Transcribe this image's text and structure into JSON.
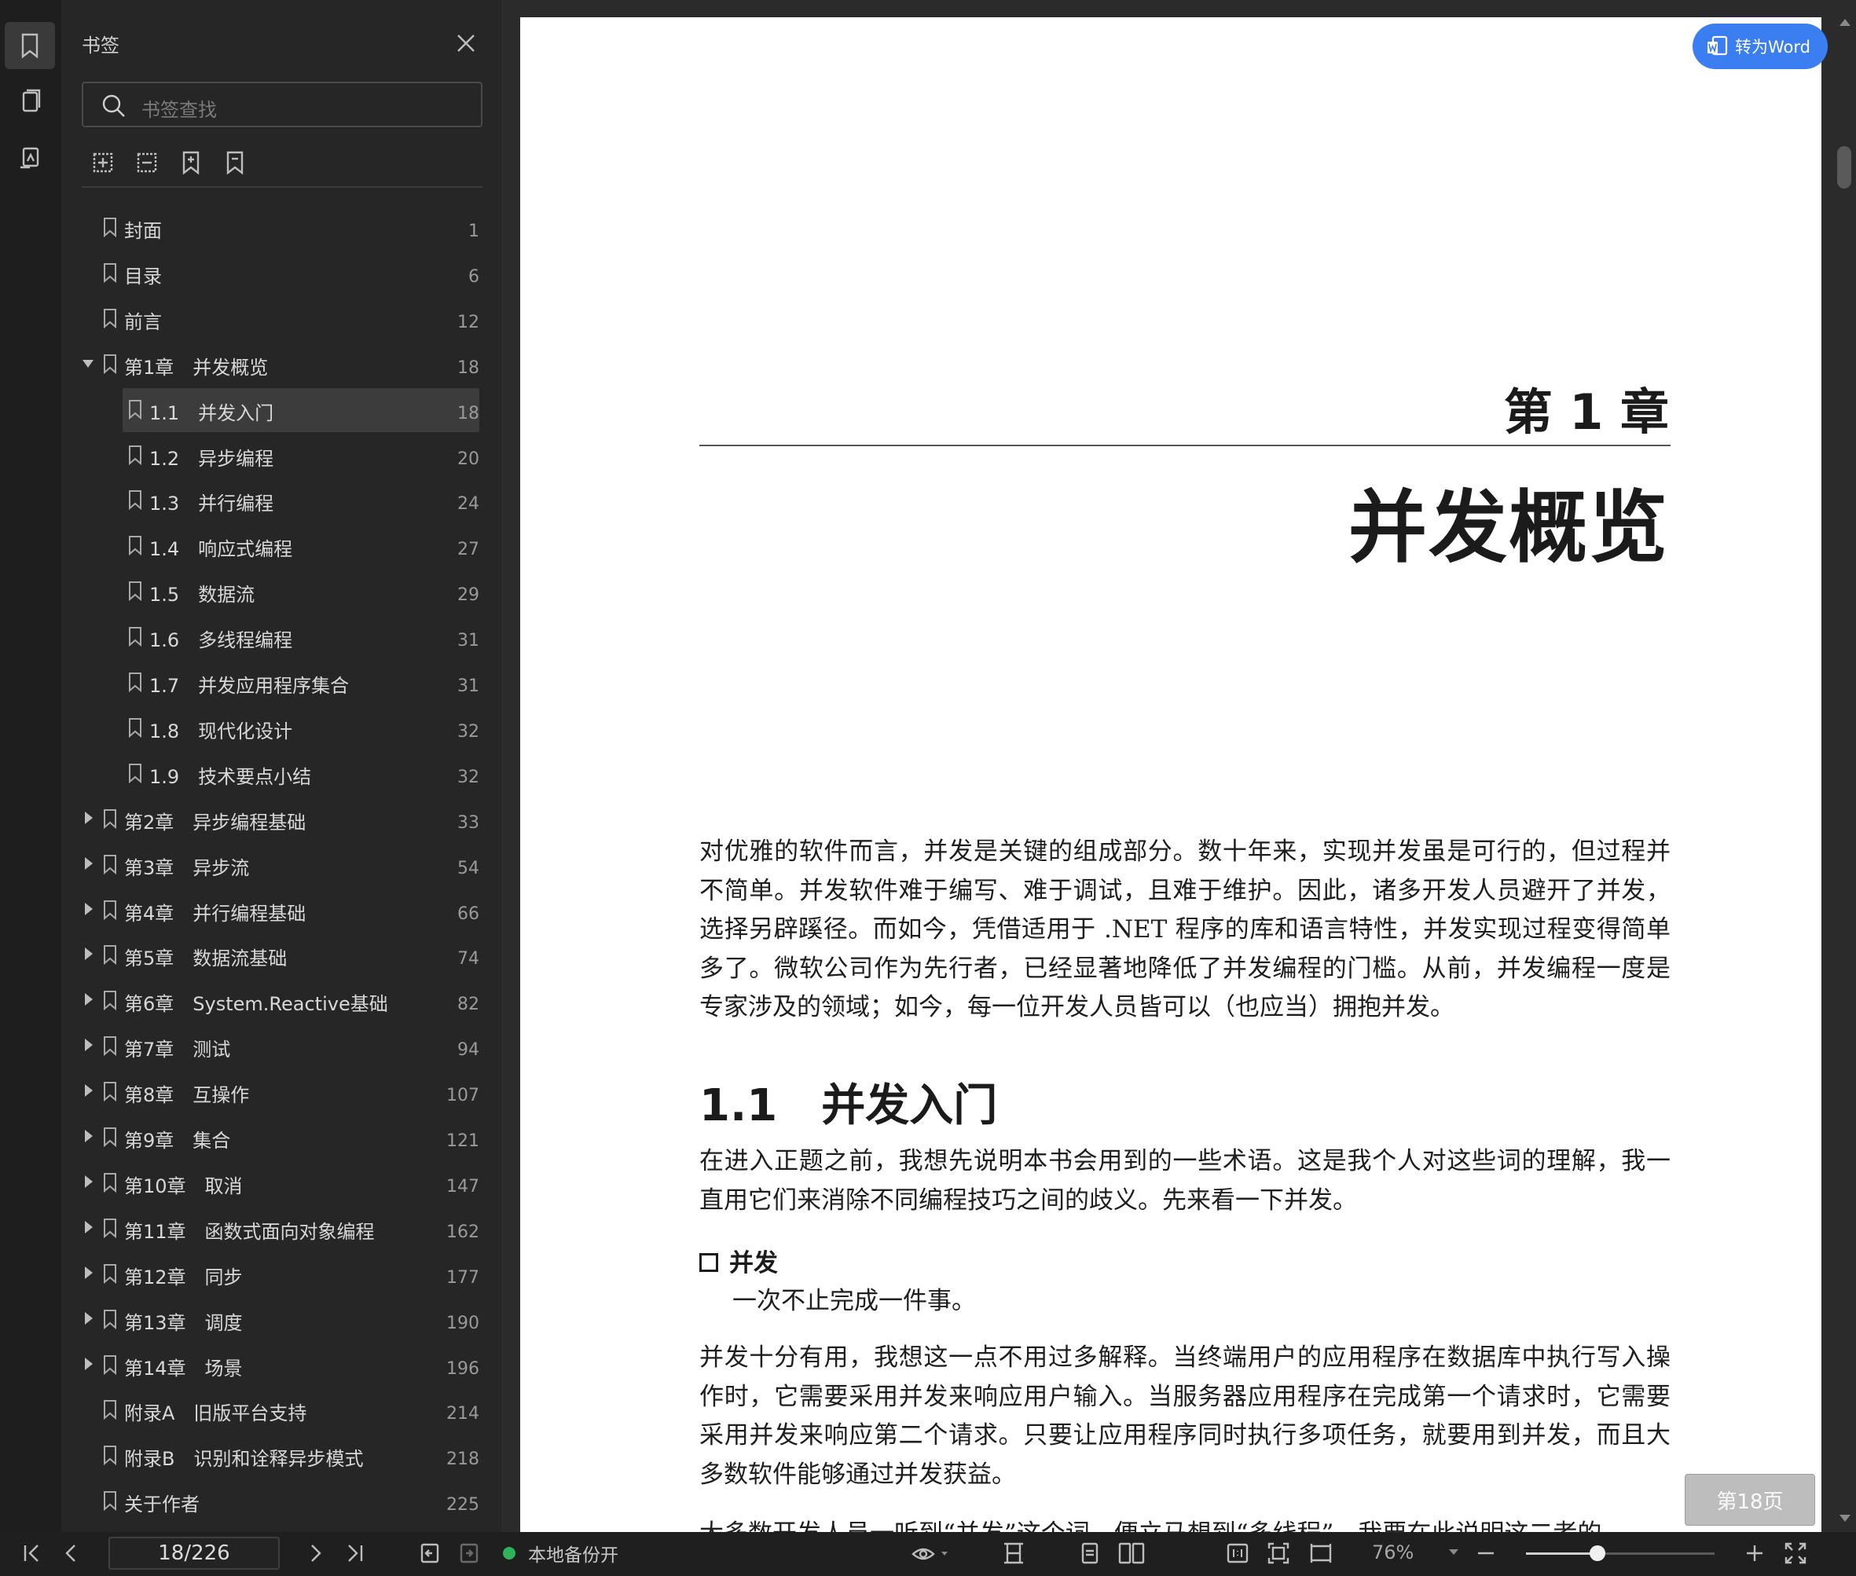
{
  "sidebar": {
    "title": "书签",
    "search_placeholder": "书签查找",
    "items": [
      {
        "label": "封面",
        "page": "1",
        "level": 0,
        "expander": "none"
      },
      {
        "label": "目录",
        "page": "6",
        "level": 0,
        "expander": "none"
      },
      {
        "label": "前言",
        "page": "12",
        "level": 0,
        "expander": "none"
      },
      {
        "label": "第1章　并发概览",
        "page": "18",
        "level": 0,
        "expander": "expanded"
      },
      {
        "label": "1.1　并发入门",
        "page": "18",
        "level": 1,
        "expander": "none",
        "selected": true
      },
      {
        "label": "1.2　异步编程",
        "page": "20",
        "level": 1,
        "expander": "none"
      },
      {
        "label": "1.3　并行编程",
        "page": "24",
        "level": 1,
        "expander": "none"
      },
      {
        "label": "1.4　响应式编程",
        "page": "27",
        "level": 1,
        "expander": "none"
      },
      {
        "label": "1.5　数据流",
        "page": "29",
        "level": 1,
        "expander": "none"
      },
      {
        "label": "1.6　多线程编程",
        "page": "31",
        "level": 1,
        "expander": "none"
      },
      {
        "label": "1.7　并发应用程序集合",
        "page": "31",
        "level": 1,
        "expander": "none"
      },
      {
        "label": "1.8　现代化设计",
        "page": "32",
        "level": 1,
        "expander": "none"
      },
      {
        "label": "1.9　技术要点小结",
        "page": "32",
        "level": 1,
        "expander": "none"
      },
      {
        "label": "第2章　异步编程基础",
        "page": "33",
        "level": 0,
        "expander": "collapsed"
      },
      {
        "label": "第3章　异步流",
        "page": "54",
        "level": 0,
        "expander": "collapsed"
      },
      {
        "label": "第4章　并行编程基础",
        "page": "66",
        "level": 0,
        "expander": "collapsed"
      },
      {
        "label": "第5章　数据流基础",
        "page": "74",
        "level": 0,
        "expander": "collapsed"
      },
      {
        "label": "第6章　System.Reactive基础",
        "page": "82",
        "level": 0,
        "expander": "collapsed"
      },
      {
        "label": "第7章　测试",
        "page": "94",
        "level": 0,
        "expander": "collapsed"
      },
      {
        "label": "第8章　互操作",
        "page": "107",
        "level": 0,
        "expander": "collapsed"
      },
      {
        "label": "第9章　集合",
        "page": "121",
        "level": 0,
        "expander": "collapsed"
      },
      {
        "label": "第10章　取消",
        "page": "147",
        "level": 0,
        "expander": "collapsed"
      },
      {
        "label": "第11章　函数式面向对象编程",
        "page": "162",
        "level": 0,
        "expander": "collapsed"
      },
      {
        "label": "第12章　同步",
        "page": "177",
        "level": 0,
        "expander": "collapsed"
      },
      {
        "label": "第13章　调度",
        "page": "190",
        "level": 0,
        "expander": "collapsed"
      },
      {
        "label": "第14章　场景",
        "page": "196",
        "level": 0,
        "expander": "collapsed"
      },
      {
        "label": "附录A　旧版平台支持",
        "page": "214",
        "level": 0,
        "expander": "none"
      },
      {
        "label": "附录B　识别和诠释异步模式",
        "page": "218",
        "level": 0,
        "expander": "none"
      },
      {
        "label": "关于作者",
        "page": "225",
        "level": 0,
        "expander": "none"
      }
    ]
  },
  "document": {
    "convert_button": "转为Word",
    "chapter_number": "第 1 章",
    "chapter_title": "并发概览",
    "intro": "对优雅的软件而言，并发是关键的组成部分。数十年来，实现并发虽是可行的，但过程并不简单。并发软件难于编写、难于调试，且难于维护。因此，诸多开发人员避开了并发，选择另辟蹊径。而如今，凭借适用于 .NET 程序的库和语言特性，并发实现过程变得简单多了。微软公司作为先行者，已经显著地降低了并发编程的门槛。从前，并发编程一度是专家涉及的领域；如今，每一位开发人员皆可以（也应当）拥抱并发。",
    "section_title": "1.1　并发入门",
    "section_intro": "在进入正题之前，我想先说明本书会用到的一些术语。这是我个人对这些词的理解，我一直用它们来消除不同编程技巧之间的歧义。先来看一下并发。",
    "term": "并发",
    "term_definition": "一次不止完成一件事。",
    "para2": "并发十分有用，我想这一点不用过多解释。当终端用户的应用程序在数据库中执行写入操作时，它需要采用并发来响应用户输入。当服务器应用程序在完成第一个请求时，它需要采用并发来响应第二个请求。只要让应用程序同时执行多项任务，就要用到并发，而且大多数软件能够通过并发获益。",
    "para3": "大多数开发人员一听到“并发”这个词，便立马想到“多线程”。我要在此说明这二者的",
    "page_badge": "第18页"
  },
  "statusbar": {
    "page_input": "18/226",
    "backup_status": "本地备份开",
    "zoom": "76%",
    "zoom_level": 0.38
  },
  "colors": {
    "accent": "#3a7ef2",
    "backup_dot": "#2eb35a"
  }
}
